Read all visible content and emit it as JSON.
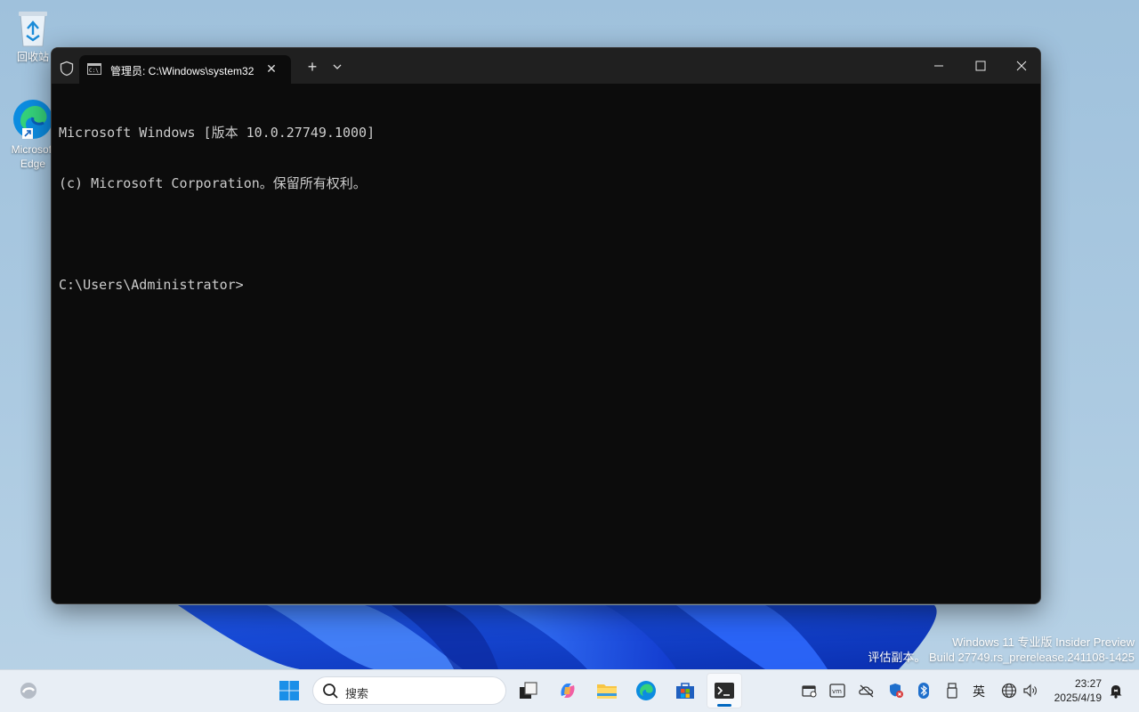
{
  "desktop": {
    "icons": [
      {
        "label": "回收站"
      },
      {
        "label": "Microsoft Edge"
      }
    ]
  },
  "terminal": {
    "tab_title": "管理员: C:\\Windows\\system32",
    "tab_close_glyph": "✕",
    "new_tab_glyph": "+",
    "lines": [
      "Microsoft Windows [版本 10.0.27749.1000]",
      "(c) Microsoft Corporation。保留所有权利。",
      "",
      "C:\\Users\\Administrator>"
    ],
    "colors": {
      "background": "#0c0c0c",
      "text": "#cccccc",
      "titlebar": "#202020"
    }
  },
  "watermark": {
    "line1": "Windows 11 专业版 Insider Preview",
    "line2": "评估副本。 Build 27749.rs_prerelease.241108-1425"
  },
  "taskbar": {
    "search_placeholder": "搜索",
    "pinned": [
      "start-icon",
      "task-view-icon",
      "copilot-icon",
      "file-explorer-icon",
      "edge-icon",
      "store-icon",
      "terminal-icon"
    ],
    "tray": {
      "ime": "英",
      "time": "23:27",
      "date": "2025/4/19"
    },
    "accent": "#0067c0"
  }
}
